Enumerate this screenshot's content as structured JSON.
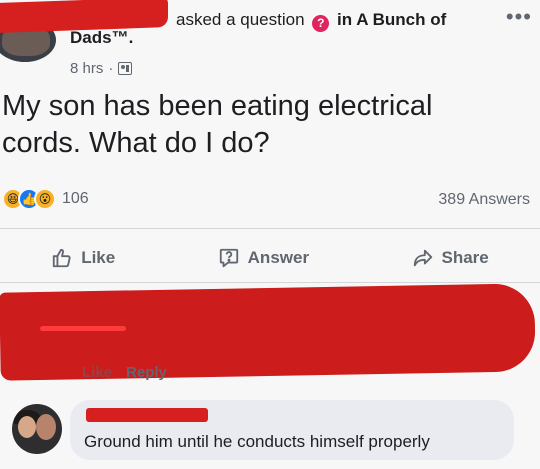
{
  "post": {
    "action_text": "asked a question",
    "in_text": "in A Bunch of",
    "group_name": "Dads™.",
    "timestamp": "8 hrs",
    "separator": "·",
    "privacy_icon": "group-privacy-icon",
    "question_badge_glyph": "?",
    "more_glyph": "•••",
    "body_line1": "My son has been eating electrical",
    "body_line2": "cords. What do I do?"
  },
  "stats": {
    "reaction_icons": [
      "haha-icon",
      "like-icon",
      "wow-icon"
    ],
    "reaction_count": "106",
    "answers_count": "389 Answers"
  },
  "actions": {
    "like_label": "Like",
    "answer_label": "Answer",
    "share_label": "Share"
  },
  "redacted_comment": {
    "like_label": "Like",
    "reply_label": "Reply"
  },
  "comment": {
    "text": "Ground him until he conducts himself properly"
  },
  "colors": {
    "redaction": "#d62020",
    "question_badge": "#e0245e",
    "muted_text": "#606770",
    "bubble_bg": "#e9ebf0"
  }
}
